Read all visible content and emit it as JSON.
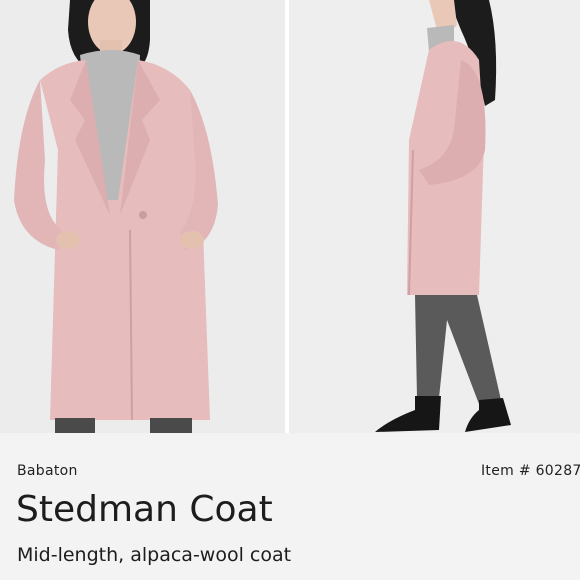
{
  "product": {
    "brand": "Babaton",
    "item_number": "Item # 60287",
    "title": "Stedman Coat",
    "description": "Mid-length, alpaca-wool coat"
  },
  "colors": {
    "coat": "#e6bcbc",
    "coat_shadow": "#d9a9aa",
    "sweater": "#b9b9b9",
    "hair": "#1c1c1c",
    "skin": "#e9c8b8",
    "trousers": "#5a5a5a",
    "boots": "#161616",
    "background": "#ededed"
  }
}
